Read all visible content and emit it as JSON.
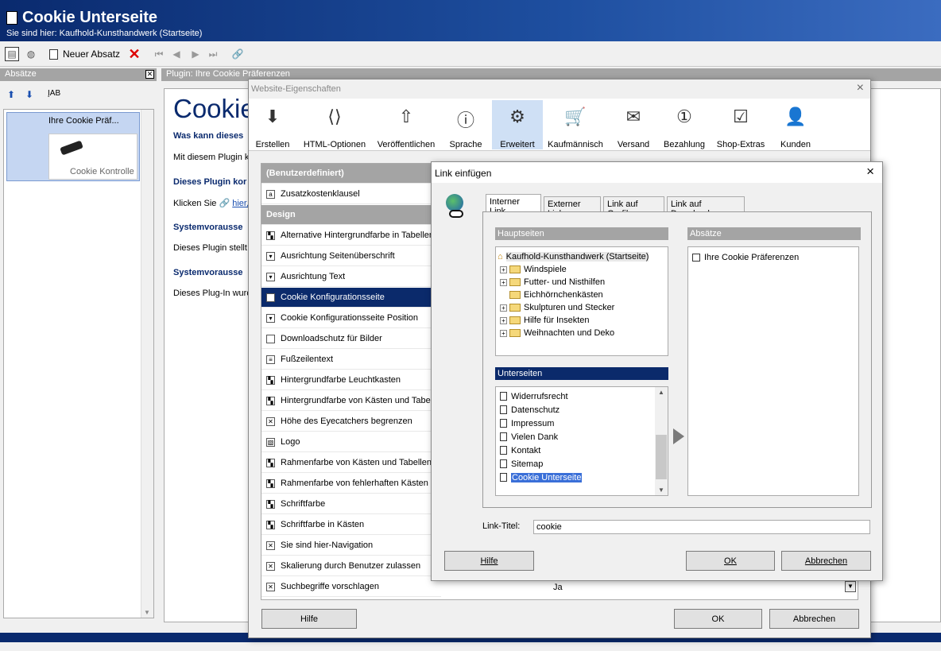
{
  "header": {
    "title": "Cookie Unterseite",
    "breadcrumb": "Sie sind hier: Kaufhold-Kunsthandwerk (Startseite)"
  },
  "toolbar": {
    "new_paragraph": "Neuer Absatz"
  },
  "left_panel": {
    "title": "Absätze",
    "item_title": "Ihre Cookie Präf...",
    "item_caption": "Cookie Kontrolle"
  },
  "plugin_panel": {
    "title": "Plugin: Ihre Cookie Präferenzen",
    "heading": "Cookie",
    "sub1": "Was kann dieses",
    "text1": "Mit diesem Plugin kö",
    "sub2": "Dieses Plugin kor",
    "text2a": "Klicken Sie",
    "text2b": "hier,",
    "sub3": "Systemvorausse",
    "text3": "Dieses Plugin stellt k",
    "sub4": "Systemvorausse",
    "text4": "Dieses Plug-In wurd"
  },
  "props": {
    "title": "Website-Eigenschaften",
    "tabs": [
      "Erstellen",
      "HTML-Optionen",
      "Veröffentlichen",
      "Sprache",
      "Erweitert",
      "Kaufmännisch",
      "Versand",
      "Bezahlung",
      "Shop-Extras",
      "Kunden"
    ],
    "rows": [
      {
        "label": "(Benutzerdefiniert)",
        "kind": "sec"
      },
      {
        "label": "Zusatzkostenklausel",
        "kind": "a"
      },
      {
        "label": "Design",
        "kind": "sec"
      },
      {
        "label": "Alternative Hintergrundfarbe in Tabellen",
        "kind": "c"
      },
      {
        "label": "Ausrichtung Seitenüberschrift",
        "kind": "d"
      },
      {
        "label": "Ausrichtung Text",
        "kind": "d"
      },
      {
        "label": "Cookie Konfigurationsseite",
        "kind": "p",
        "sel": true
      },
      {
        "label": "Cookie Konfigurationsseite Position",
        "kind": "d"
      },
      {
        "label": "Downloadschutz für Bilder",
        "kind": "e"
      },
      {
        "label": "Fußzeilentext",
        "kind": "t"
      },
      {
        "label": "Hintergrundfarbe Leuchtkasten",
        "kind": "c"
      },
      {
        "label": "Hintergrundfarbe von Kästen und Tabellen",
        "kind": "c"
      },
      {
        "label": "Höhe des Eyecatchers begrenzen",
        "kind": "x"
      },
      {
        "label": "Logo",
        "kind": "i"
      },
      {
        "label": "Rahmenfarbe von Kästen und Tabellen",
        "kind": "c"
      },
      {
        "label": "Rahmenfarbe von fehlerhaften Kästen",
        "kind": "c"
      },
      {
        "label": "Schriftfarbe",
        "kind": "c"
      },
      {
        "label": "Schriftfarbe in Kästen",
        "kind": "c"
      },
      {
        "label": "Sie sind hier-Navigation",
        "kind": "x"
      },
      {
        "label": "Skalierung durch Benutzer zulassen",
        "kind": "x"
      },
      {
        "label": "Suchbegriffe vorschlagen",
        "kind": "x"
      }
    ],
    "last_value": "Ja",
    "help": "Hilfe",
    "ok": "OK",
    "cancel": "Abbrechen"
  },
  "link": {
    "title": "Link einfügen",
    "tabs": [
      "Interner Link",
      "Externer Link",
      "Link auf Grafik",
      "Link auf Download"
    ],
    "main_pages_label": "Hauptseiten",
    "paragraphs_label": "Absätze",
    "subpages_label": "Unterseiten",
    "root": "Kaufhold-Kunsthandwerk (Startseite)",
    "folders": [
      {
        "label": "Windspiele",
        "exp": true
      },
      {
        "label": "Futter- und Nisthilfen",
        "exp": true
      },
      {
        "label": "Eichhörnchenkästen",
        "exp": false
      },
      {
        "label": "Skulpturen und Stecker",
        "exp": true
      },
      {
        "label": "Hilfe für Insekten",
        "exp": true
      },
      {
        "label": "Weihnachten und Deko",
        "exp": true
      }
    ],
    "subpages": [
      "Widerrufsrecht",
      "Datenschutz",
      "Impressum",
      "Vielen Dank",
      "Kontakt",
      "Sitemap",
      "Cookie Unterseite"
    ],
    "paragraph_item": "Ihre Cookie Präferenzen",
    "link_title_label": "Link-Titel:",
    "link_title_value": "cookie",
    "help": "Hilfe",
    "ok": "OK",
    "cancel": "Abbrechen"
  }
}
